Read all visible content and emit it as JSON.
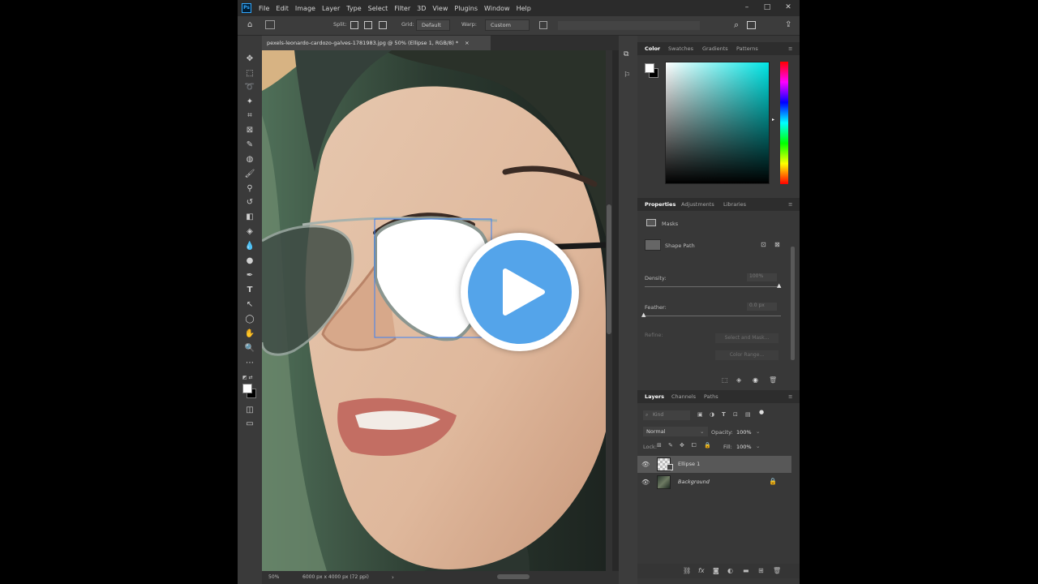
{
  "menubar": {
    "logo": "Ps",
    "items": [
      "File",
      "Edit",
      "Image",
      "Layer",
      "Type",
      "Select",
      "Filter",
      "3D",
      "View",
      "Plugins",
      "Window",
      "Help"
    ],
    "window_controls": {
      "minimize": "–",
      "maximize": "□",
      "close": "✕"
    }
  },
  "options_bar": {
    "split_label": "Split:",
    "grid_label": "Grid:",
    "grid_value": "Default",
    "warp_label": "Warp:",
    "warp_value": "Custom"
  },
  "document": {
    "tab_title": "pexels-leonardo-cardozo-galves-1781983.jpg @ 50% (Ellipse 1, RGB/8) *",
    "tab_close": "×"
  },
  "status_bar": {
    "zoom": "50%",
    "info": "6000 px x 4000 px (72 ppi)"
  },
  "color_panel": {
    "tabs": [
      "Color",
      "Swatches",
      "Gradients",
      "Patterns"
    ],
    "active_tab": "Color"
  },
  "properties_panel": {
    "tabs": [
      "Properties",
      "Adjustments",
      "Libraries"
    ],
    "active_tab": "Properties",
    "masks_label": "Masks",
    "shape_path_label": "Shape Path",
    "density_label": "Density:",
    "density_value": "100%",
    "feather_label": "Feather:",
    "feather_value": "0.0 px",
    "refine_label": "Refine:",
    "select_and_mask": "Select and Mask...",
    "color_range": "Color Range..."
  },
  "layers_panel": {
    "tabs": [
      "Layers",
      "Channels",
      "Paths"
    ],
    "active_tab": "Layers",
    "filter_placeholder": "Kind",
    "blend_mode": "Normal",
    "opacity_label": "Opacity:",
    "opacity_value": "100%",
    "lock_label": "Lock:",
    "fill_label": "Fill:",
    "fill_value": "100%",
    "layers": [
      {
        "name": "Ellipse 1",
        "visible": true,
        "selected": true
      },
      {
        "name": "Background",
        "visible": true,
        "selected": false,
        "locked": true
      }
    ]
  },
  "overlay": {
    "icon": "play-icon"
  },
  "colors": {
    "app_bg": "#535353",
    "panel_bg": "#383838",
    "play_blue": "#54a4ea",
    "hue_strip": "rainbow"
  }
}
